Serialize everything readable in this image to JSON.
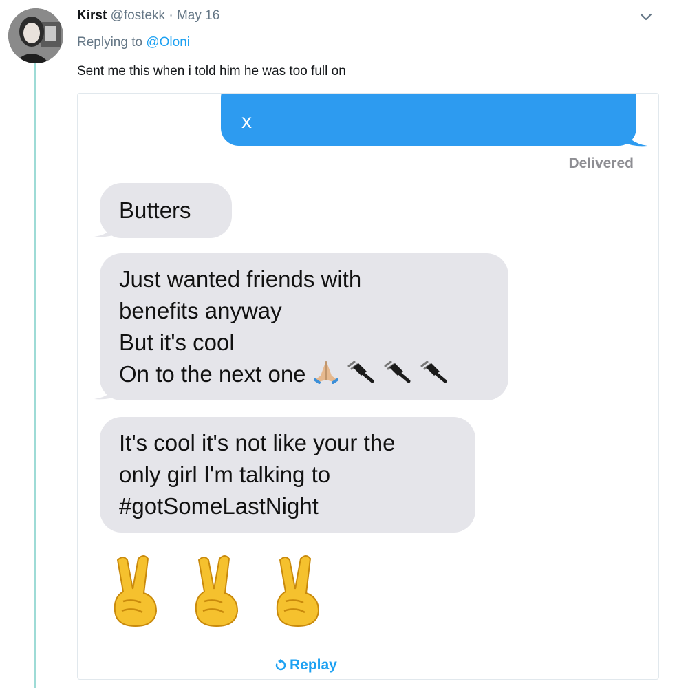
{
  "tweet": {
    "author_name": "Kirst",
    "author_handle": "@fostekk",
    "separator": "·",
    "date": "May 16",
    "replying_prefix": "Replying to",
    "replying_to": "@Oloni",
    "text": "Sent me this when i told him he was too full on"
  },
  "media": {
    "sent_fragment": "x",
    "status": "Delivered",
    "messages": [
      {
        "lines": [
          "Butters"
        ]
      },
      {
        "lines": [
          "Just wanted friends with",
          "benefits anyway",
          "But it's cool",
          "On to the next one"
        ]
      },
      {
        "lines": [
          "It's cool it's not like your the",
          "only girl I'm talking to",
          "#gotSomeLastNight"
        ]
      }
    ],
    "replay_label": "Replay"
  },
  "icons": {
    "caret": "chevron-down-icon",
    "replay": "replay-icon",
    "folded_hands": "folded-hands-emoji",
    "plug": "electric-plug-emoji",
    "peace": "victory-hand-emoji"
  },
  "colors": {
    "imessage_blue": "#2d9bf0",
    "received_gray": "#e5e5ea",
    "twitter_blue": "#1da1f2",
    "thread_line": "#9edbd6",
    "muted": "#657786"
  }
}
